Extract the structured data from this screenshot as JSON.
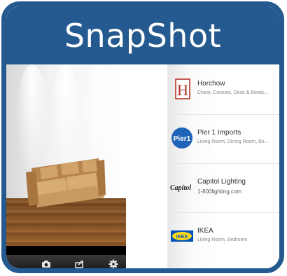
{
  "header": {
    "title": "SnapShot"
  },
  "toolbar": {
    "items": [
      "camera-icon",
      "share-icon",
      "gear-icon"
    ]
  },
  "stores": [
    {
      "name": "Horchow",
      "subtitle": "Chest, Console, Desk & Bookc...",
      "logo": "H"
    },
    {
      "name": "Pier 1 Imports",
      "subtitle": "Living Room, Dining Room, Be...",
      "logo": "Pier1"
    },
    {
      "name": "Capitol Lighting",
      "subtitle": "1-800lighting.com",
      "logo": "Capitol"
    },
    {
      "name": "IKEA",
      "subtitle": "Living Room, Bedroom",
      "logo": "IKEA"
    }
  ],
  "colors": {
    "frame": "#245a8f",
    "title_text": "#ffffff",
    "floor": "#8b5628",
    "sofa": "#c89a62"
  }
}
